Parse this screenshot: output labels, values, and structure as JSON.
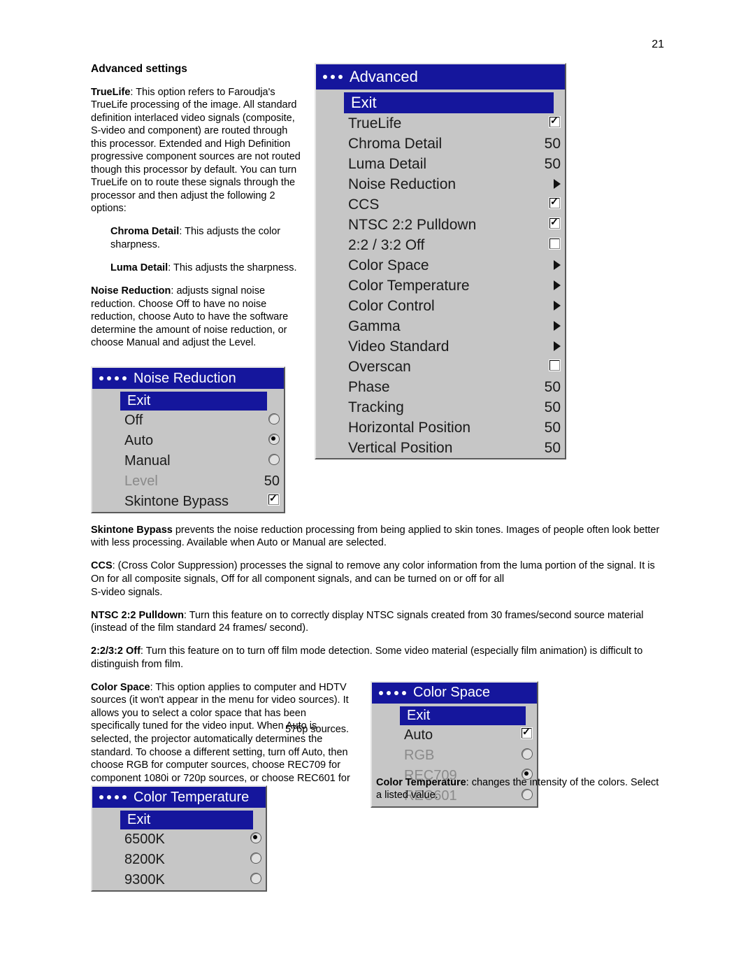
{
  "page_number": "21",
  "heading": "Advanced settings",
  "truelife_intro_bold": "TrueLife",
  "truelife_intro_text": ": This option refers to Faroudja's TrueLife processing of the image. All standard definition interlaced video signals (composite, S-video and component) are routed through this processor.  Extended and High Definition progressive component sources are not routed though this processor by default.  You can turn TrueLife on to route these signals through the processor and then adjust the following 2 options:",
  "chroma_bold": "Chroma Detail",
  "chroma_text": ": This adjusts the color sharpness.",
  "luma_bold": "Luma Detail",
  "luma_text": ": This adjusts the sharpness.",
  "nr_bold": "Noise Reduction",
  "nr_text": ": adjusts signal noise reduction. Choose Off to have no noise reduction, choose Auto to have the software determine the amount of noise reduction, or choose Manual and adjust the Level.",
  "skintone_bold": "Skintone Bypass",
  "skintone_text": " prevents the noise reduction processing from being applied to skin tones. Images of people often look better with less processing. Available when Auto or Manual are selected.",
  "ccs_bold": "CCS",
  "ccs_text": ": (Cross Color Suppression) processes the signal to remove any color information from the luma portion of the signal. It is On for all composite signals, Off for all component signals, and can be turned on or off for all",
  "ccs_text2": "S-video signals.",
  "ntsc_bold": "NTSC 2:2 Pulldown",
  "ntsc_text": ": Turn this feature on to correctly display NTSC signals created from 30 frames/second source material (instead of the film standard 24 frames/ second).",
  "off_bold": "2:2/3:2 Off",
  "off_text": ": Turn this feature on to turn off film mode detection. Some video material (especially film animation) is difficult to distinguish from film.",
  "cs_bold": "Color Space",
  "cs_text": ": This option applies to computer and HDTV sources (it won't appear in the menu for video sources). It allows you to select a color space that has been specifically tuned for the video input. When Auto is selected, the projector automatically determines the standard. To choose a different setting, turn off Auto, then choose RGB for computer sources, choose REC709 for component 1080i or 720p sources, or choose REC601 for component 480p or",
  "cs_text_tail": "576p sources.",
  "ct_bold": "Color Temperature",
  "ct_text": ": changes the intensity of the colors. Select a listed value.",
  "advanced_menu": {
    "title": "Advanced",
    "exit": "Exit",
    "rows": [
      {
        "label": "TrueLife",
        "value": "",
        "ctrl": "checkbox_checked"
      },
      {
        "label": "Chroma Detail",
        "value": "50",
        "ctrl": "value"
      },
      {
        "label": "Luma Detail",
        "value": "50",
        "ctrl": "value"
      },
      {
        "label": "Noise Reduction",
        "value": "",
        "ctrl": "arrow"
      },
      {
        "label": "CCS",
        "value": "",
        "ctrl": "checkbox_checked"
      },
      {
        "label": "NTSC 2:2 Pulldown",
        "value": "",
        "ctrl": "checkbox_checked"
      },
      {
        "label": "2:2 / 3:2 Off",
        "value": "",
        "ctrl": "checkbox"
      },
      {
        "label": "Color Space",
        "value": "",
        "ctrl": "arrow"
      },
      {
        "label": "Color Temperature",
        "value": "",
        "ctrl": "arrow"
      },
      {
        "label": "Color Control",
        "value": "",
        "ctrl": "arrow"
      },
      {
        "label": "Gamma",
        "value": "",
        "ctrl": "arrow"
      },
      {
        "label": "Video Standard",
        "value": "",
        "ctrl": "arrow"
      },
      {
        "label": "Overscan",
        "value": "",
        "ctrl": "checkbox"
      },
      {
        "label": "Phase",
        "value": "50",
        "ctrl": "value"
      },
      {
        "label": "Tracking",
        "value": "50",
        "ctrl": "value"
      },
      {
        "label": "Horizontal Position",
        "value": "50",
        "ctrl": "value"
      },
      {
        "label": "Vertical Position",
        "value": "50",
        "ctrl": "value"
      }
    ]
  },
  "nr_menu": {
    "title": "Noise Reduction",
    "exit": "Exit",
    "rows": [
      {
        "label": "Off",
        "ctrl": "radio"
      },
      {
        "label": "Auto",
        "ctrl": "radio_checked"
      },
      {
        "label": "Manual",
        "ctrl": "radio"
      },
      {
        "label": "Level",
        "value": "50",
        "ctrl": "value",
        "disabled": true
      },
      {
        "label": "Skintone Bypass",
        "ctrl": "checkbox_checked"
      }
    ]
  },
  "cs_menu": {
    "title": "Color Space",
    "exit": "Exit",
    "rows": [
      {
        "label": "Auto",
        "ctrl": "checkbox_checked"
      },
      {
        "label": "RGB",
        "ctrl": "radio",
        "disabled": true
      },
      {
        "label": "REC709",
        "ctrl": "radio_checked",
        "disabled": true
      },
      {
        "label": "REC601",
        "ctrl": "radio",
        "disabled": true
      }
    ]
  },
  "ct_menu": {
    "title": "Color Temperature",
    "exit": "Exit",
    "rows": [
      {
        "label": "6500K",
        "ctrl": "radio_checked"
      },
      {
        "label": "8200K",
        "ctrl": "radio"
      },
      {
        "label": "9300K",
        "ctrl": "radio"
      }
    ]
  }
}
